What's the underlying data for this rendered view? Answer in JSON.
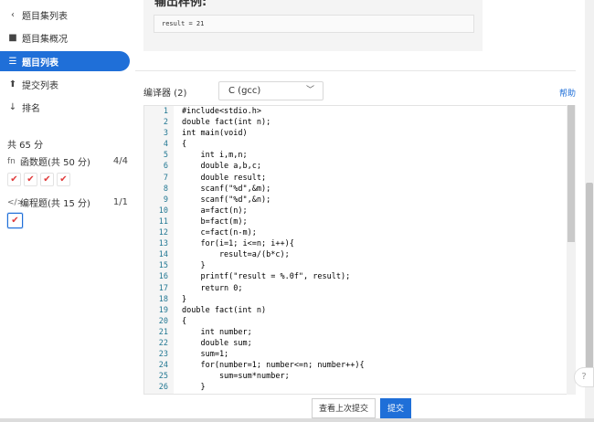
{
  "sidebar": {
    "items": [
      {
        "icon": "chevron-left-icon",
        "glyph": "‹",
        "label": "题目集列表"
      },
      {
        "icon": "book-icon",
        "glyph": "■",
        "label": "题目集概况"
      },
      {
        "icon": "list-icon",
        "glyph": "☰",
        "label": "题目列表"
      },
      {
        "icon": "upload-icon",
        "glyph": "⬆",
        "label": "提交列表"
      },
      {
        "icon": "sort-icon",
        "glyph": "↓",
        "label": "排名"
      }
    ],
    "total": "共 65 分",
    "categories": [
      {
        "icon": "function-icon",
        "glyph": "fn",
        "label": "函数题(共 50 分)",
        "count": "4/4"
      },
      {
        "icon": "code-icon",
        "glyph": "</>",
        "label": "编程题(共 15 分)",
        "count": "1/1"
      }
    ],
    "check_mark": "✔"
  },
  "top_card": {
    "title_cut": "输出样例:",
    "result": "result = 21"
  },
  "compiler": {
    "label": "编译器 (2)",
    "selected": "C (gcc)",
    "help": "帮助"
  },
  "code_lines": [
    "#include<stdio.h>",
    "double fact(int n);",
    "int main(void)",
    "{",
    "    int i,m,n;",
    "    double a,b,c;",
    "    double result;",
    "    scanf(\"%d\",&m);",
    "    scanf(\"%d\",&n);",
    "    a=fact(n);",
    "    b=fact(m);",
    "    c=fact(n-m);",
    "    for(i=1; i<=n; i++){",
    "        result=a/(b*c);",
    "    }",
    "    printf(\"result = %.0f\", result);",
    "    return 0;",
    "}",
    "double fact(int n)",
    "{",
    "    int number;",
    "    double sum;",
    "    sum=1;",
    "    for(number=1; number<=n; number++){",
    "        sum=sum*number;",
    "    }"
  ],
  "buttons": {
    "last_submit": "查看上次提交",
    "submit": "提交"
  },
  "colors": {
    "accent": "#1f6fd8",
    "check": "#e03b3b"
  }
}
